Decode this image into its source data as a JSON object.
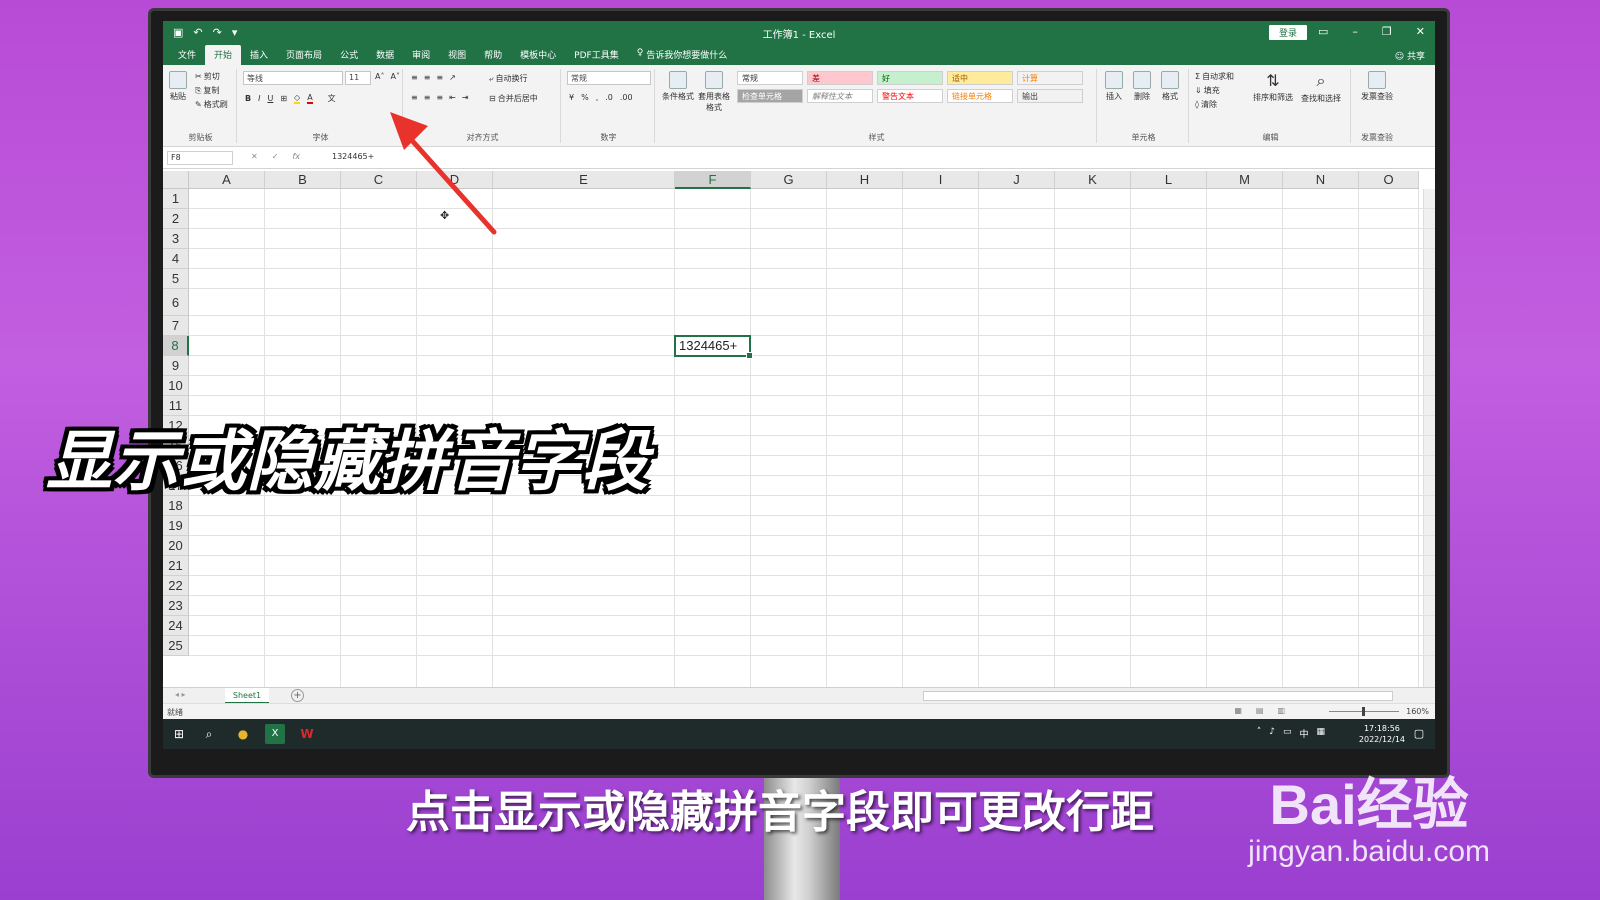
{
  "titlebar": {
    "title": "工作簿1 - Excel",
    "login": "登录",
    "qa_icons": [
      "save-icon",
      "undo-icon",
      "redo-icon",
      "customize-icon"
    ]
  },
  "tabs": [
    "文件",
    "开始",
    "插入",
    "页面布局",
    "公式",
    "数据",
    "审阅",
    "视图",
    "帮助",
    "模板中心",
    "PDF工具集"
  ],
  "tell_me": "告诉我你想要做什么",
  "share": "共享",
  "ribbon": {
    "clipboard": {
      "paste": "粘贴",
      "cut": "剪切",
      "copy": "复制",
      "format_painter": "格式刷",
      "label": "剪贴板"
    },
    "font": {
      "name": "等线",
      "size": "11",
      "label": "字体"
    },
    "alignment": {
      "wrap": "自动换行",
      "merge": "合并后居中",
      "label": "对齐方式"
    },
    "number": {
      "format": "常规",
      "label": "数字"
    },
    "styles": {
      "conditional": "条件格式",
      "table": "套用表格格式",
      "cells": [
        "常规",
        "差",
        "好",
        "适中",
        "计算",
        "检查单元格",
        "解释性文本",
        "警告文本",
        "链接单元格",
        "输出"
      ],
      "label": "样式"
    },
    "cells_group": {
      "insert": "插入",
      "delete": "删除",
      "format": "格式",
      "label": "单元格"
    },
    "editing": {
      "autosum": "自动求和",
      "fill": "填充",
      "clear": "清除",
      "sort": "排序和筛选",
      "find": "查找和选择",
      "label": "编辑"
    },
    "invoice": {
      "check": "发票查验",
      "label": "发票查验"
    }
  },
  "formula_bar": {
    "name_box": "F8",
    "fx": "fx",
    "content": "1324465+"
  },
  "grid": {
    "columns": [
      "A",
      "B",
      "C",
      "D",
      "E",
      "F",
      "G",
      "H",
      "I",
      "J",
      "K",
      "L",
      "M",
      "N",
      "O"
    ],
    "selected_column": "F",
    "rows": [
      "1",
      "2",
      "3",
      "4",
      "5",
      "6",
      "7",
      "8",
      "9",
      "10",
      "11",
      "12",
      "15",
      "16",
      "17",
      "18",
      "19",
      "20",
      "21",
      "22",
      "23",
      "24",
      "25"
    ],
    "selected_row": "8",
    "active_cell_value": "1324465+"
  },
  "sheet": {
    "tab": "Sheet1",
    "add": "+"
  },
  "status": {
    "ready": "就绪",
    "zoom": "160%"
  },
  "taskbar": {
    "time": "17:18:56",
    "date": "2022/12/14",
    "ime": "中"
  },
  "overlay": {
    "title": "显示或隐藏拼音字段",
    "subtitle": "点击显示或隐藏拼音字段即可更改行距"
  },
  "watermark": {
    "brand": "Bai经验",
    "url": "jingyan.baidu.com"
  },
  "colors": {
    "excel_green": "#217346",
    "arrow_red": "#e8322c"
  }
}
